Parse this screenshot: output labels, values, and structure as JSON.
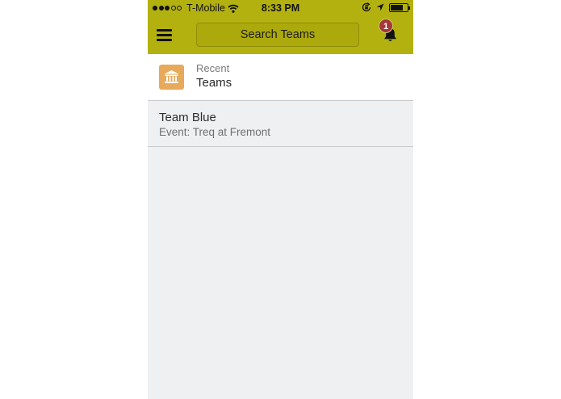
{
  "status_bar": {
    "signal_full": 3,
    "signal_total": 5,
    "carrier": "T-Mobile",
    "time": "8:33 PM",
    "battery_level": 0.75,
    "icons": [
      "wifi-icon",
      "rotation-lock-icon",
      "location-arrow-icon",
      "battery-icon"
    ]
  },
  "header": {
    "menu_icon": "hamburger-menu-icon",
    "search_label": "Search Teams",
    "notification_icon": "bell-icon",
    "notification_count": "1",
    "background_color": "#b3b10f"
  },
  "section": {
    "icon": "institution-building-icon",
    "icon_color": "#e6aa5a",
    "subtitle": "Recent",
    "title": "Teams"
  },
  "teams": [
    {
      "name": "Team Blue",
      "event": "Event: Treq at Fremont"
    }
  ],
  "badge_color": "#a5373a"
}
